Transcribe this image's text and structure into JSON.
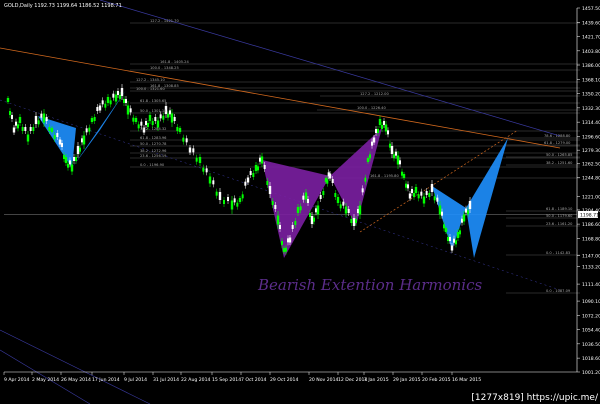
{
  "window": {
    "title": "GOLD,Daily   1192.73  1199.64  1186.52  1198.71"
  },
  "annotation_text": "Bearish Extention Harmonics",
  "watermark": "[1277x819] https://upic.me/",
  "colors": {
    "background": "#000000",
    "bull_candle": "#00ff00",
    "bear_candle": "#ffffff",
    "pattern_blue": "#1e90ff",
    "pattern_purple": "#7b1fa2",
    "trend_orange": "#d2691e",
    "channel_blue": "#3a3aa0",
    "grid": "#555555"
  },
  "chart_data": {
    "type": "candlestick",
    "symbol": "GOLD",
    "timeframe": "Daily",
    "ylim": [
      1001.2,
      1457.5
    ],
    "y_ticks": [
      "1457.50",
      "1439.60",
      "1421.70",
      "1403.80",
      "1386.00",
      "1368.10",
      "1350.20",
      "1332.30",
      "1314.40",
      "1296.60",
      "1279.30",
      "1262.50",
      "1244.80",
      "1221.00",
      "1204.40",
      "1186.60",
      "1168.80",
      "1147.00",
      "1133.20",
      "1111.40",
      "1090.10",
      "1072.20",
      "1054.40",
      "1036.50",
      "1018.60",
      "1001.20"
    ],
    "x_ticks": [
      "9 Apr 2014",
      "2 May 2014",
      "26 May 2014",
      "17 Jun 2014",
      "9 Jul 2014",
      "31 Jul 2014",
      "22 Aug 2014",
      "15 Sep 2014",
      "7 Oct 2014",
      "29 Oct 2014",
      "20 Nov 2014",
      "12 Dec 2014",
      "7 Jan 2015",
      "29 Jan 2015",
      "20 Feb 2015",
      "16 Mar 2015"
    ],
    "current_price": "1198.71",
    "fib_labels": [
      "127.2 - 1421.70",
      "161.8 - 1405.24",
      "100.0 - 1348.25",
      "161.8 - 1308.85",
      "127.2 - 1345.10",
      "100.0 - 1321.60",
      "61.8 - 1305.65",
      "50.0 - 1301.18",
      "38.2 - 1284.32",
      "61.8 - 1283.96",
      "50.0 - 1270.78",
      "38.2 - 1272.96",
      "23.6 - 1256.19",
      "0.0 - 1196.90",
      "100.0 - 1226.40",
      "127.2 - 1212.00",
      "161.8 - 1195.80",
      "78.6 - 1288.80",
      "61.8 - 1279.00",
      "50.0 - 1265.85",
      "38.2 - 1251.60",
      "61.8 - 1189.10",
      "50.0 - 1179.60",
      "23.6 - 1161.20",
      "0.0 - 1142.83",
      "0.0 - 1087.09"
    ]
  }
}
